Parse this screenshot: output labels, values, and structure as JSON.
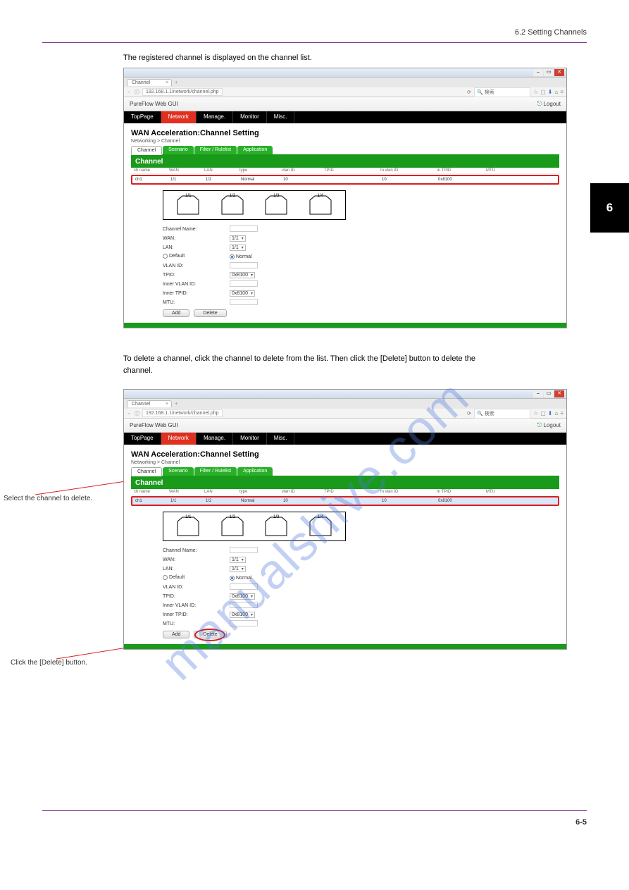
{
  "doc": {
    "section_header": "6.2   Setting Channels",
    "chapter_num": "6",
    "description_1": "The registered channel is displayed on the channel list.",
    "description_2_line1": "To delete a channel, click the channel to delete from the list. Then click the [Delete] button to delete the",
    "description_2_line2": "channel.",
    "callout_select": "Select the channel to delete.",
    "callout_click": "Click the [Delete] button.",
    "page_number": "6-5",
    "watermark": "manualshive.com"
  },
  "screenshot": {
    "tab_title": "Channel",
    "url": "192.168.1.1/network/channel.php",
    "search_placeholder": "検索",
    "gui_title": "PureFlow Web GUI",
    "logout": "Logout",
    "nav": [
      "TopPage",
      "Network",
      "Manage.",
      "Monitor",
      "Misc."
    ],
    "nav_active_index": 1,
    "page_title": "WAN Acceleration:Channel Setting",
    "breadcrumb": "Networking > Channel",
    "subtabs": [
      "Channel",
      "Scenario",
      "Filter / Rulelist",
      "Application"
    ],
    "subtab_active_index": 0,
    "panel_title": "Channel",
    "table_headers": [
      "ch name",
      "WAN",
      "LAN",
      "type",
      "vlan ID",
      "TPID",
      "In vlan ID",
      "In TPID",
      "MTU"
    ],
    "table_row": {
      "name": "ch1",
      "wan": "1/1",
      "lan": "1/2",
      "type": "Normal",
      "vlan": "10",
      "tpid": "",
      "in_vlan": "10",
      "in_tpid": "0x8100",
      "mtu": ""
    },
    "ports": [
      "1/1",
      "1/2",
      "1/3",
      "1/4"
    ],
    "form": {
      "channel_name_label": "Channel Name:",
      "wan_label": "WAN:",
      "wan_value": "1/1",
      "lan_label": "LAN:",
      "lan_value": "1/1",
      "default_label": "Default",
      "normal_label": "Normal",
      "vlan_id_label": "VLAN ID:",
      "tpid_label": "TPID:",
      "tpid_value": "0x8100",
      "inner_vlan_label": "Inner VLAN ID:",
      "inner_tpid_label": "Inner TPID:",
      "inner_tpid_value": "0x8100",
      "mtu_label": "MTU:",
      "add_btn": "Add",
      "delete_btn": "Delete"
    }
  }
}
